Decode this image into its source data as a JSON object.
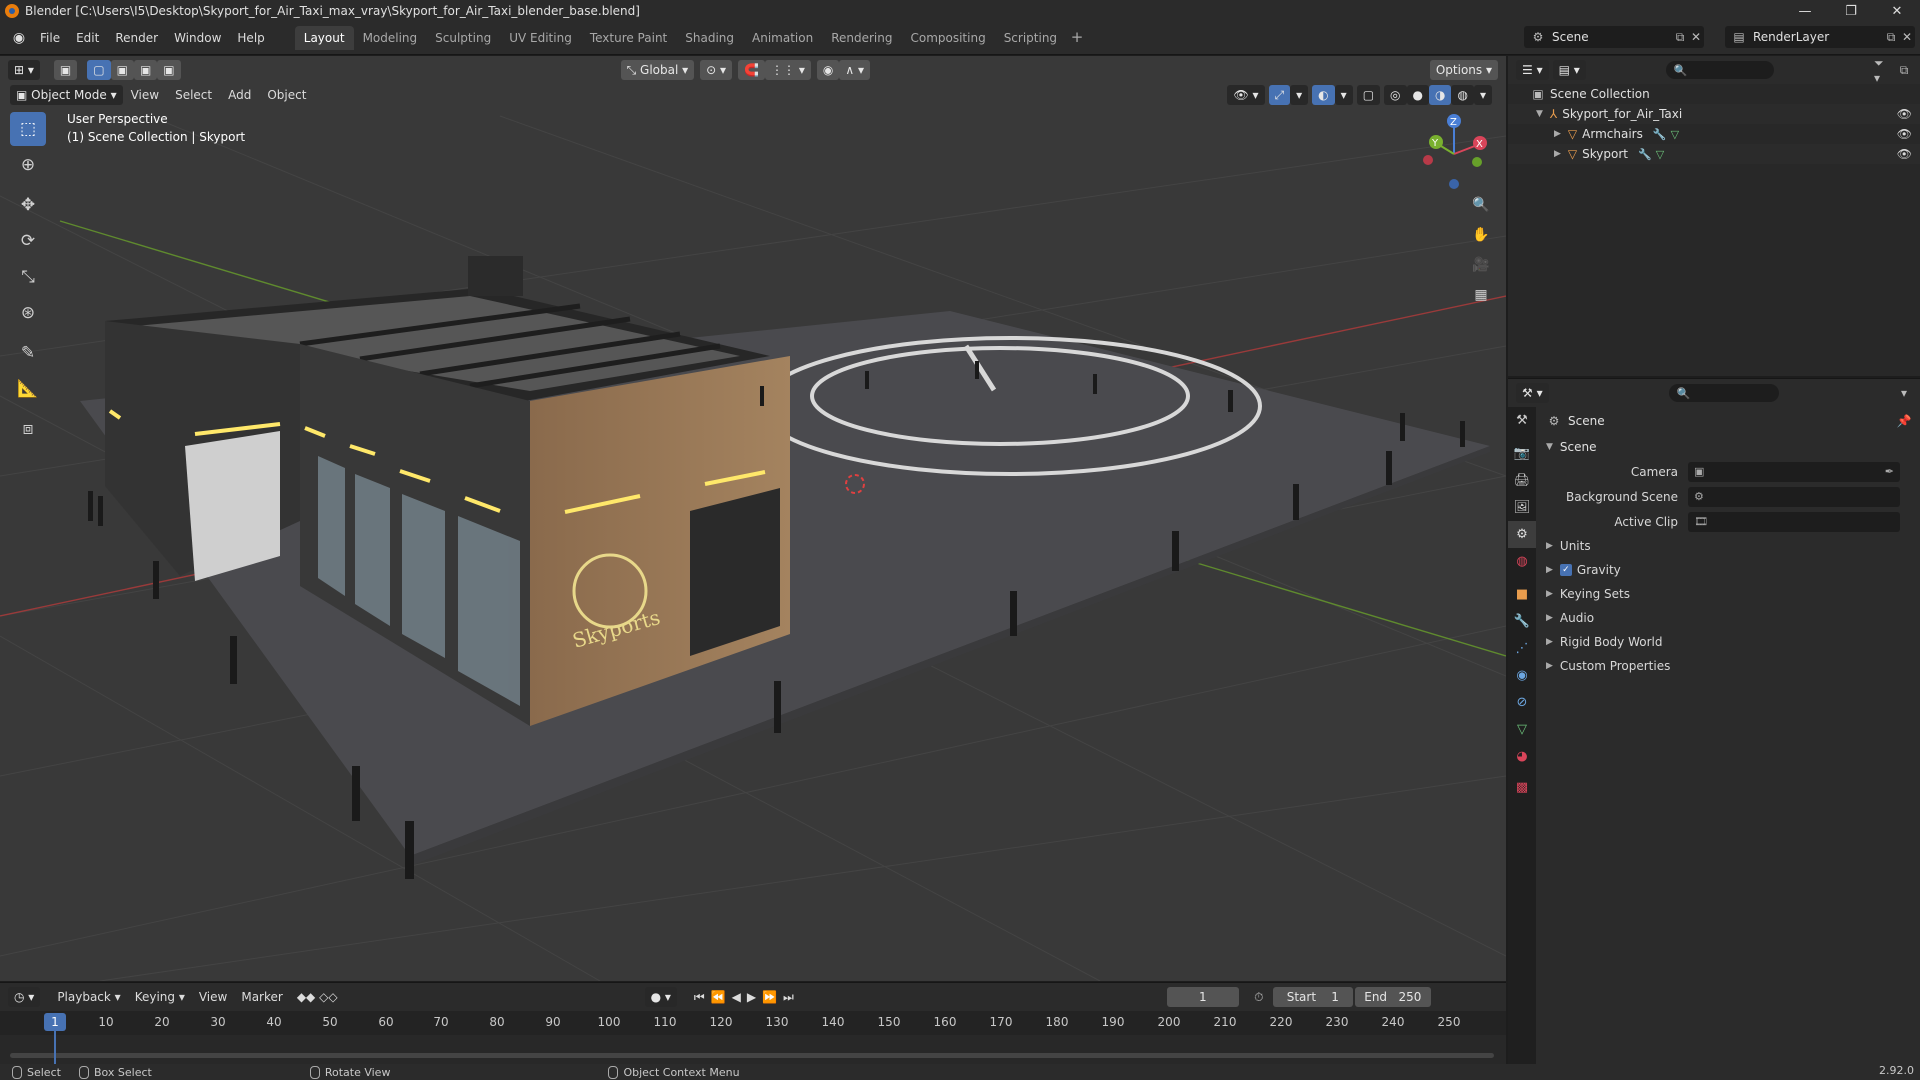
{
  "window": {
    "title": "Blender [C:\\Users\\I5\\Desktop\\Skyport_for_Air_Taxi_max_vray\\Skyport_for_Air_Taxi_blender_base.blend]",
    "minimize": "—",
    "maximize": "❐",
    "close": "✕"
  },
  "menu": [
    "File",
    "Edit",
    "Render",
    "Window",
    "Help"
  ],
  "workspaces": [
    {
      "label": "Layout",
      "active": true
    },
    {
      "label": "Modeling"
    },
    {
      "label": "Sculpting"
    },
    {
      "label": "UV Editing"
    },
    {
      "label": "Texture Paint"
    },
    {
      "label": "Shading"
    },
    {
      "label": "Animation"
    },
    {
      "label": "Rendering"
    },
    {
      "label": "Compositing"
    },
    {
      "label": "Scripting"
    }
  ],
  "top_right": {
    "scene": "Scene",
    "view_layer": "RenderLayer"
  },
  "viewport": {
    "transform_orientation": "Global",
    "options": "Options",
    "mode": "Object Mode",
    "menus": [
      "View",
      "Select",
      "Add",
      "Object"
    ],
    "overlay_line1": "User Perspective",
    "overlay_line2": "(1) Scene Collection | Skyport",
    "gizmo": {
      "x": "X",
      "y": "Y",
      "z": "Z"
    },
    "signage": "Skyports"
  },
  "timeline": {
    "menus": [
      "Playback",
      "Keying",
      "View",
      "Marker"
    ],
    "current_frame": "1",
    "start_label": "Start",
    "start": "1",
    "end_label": "End",
    "end": "250",
    "ticks": [
      "10",
      "20",
      "30",
      "40",
      "50",
      "60",
      "70",
      "80",
      "90",
      "100",
      "110",
      "120",
      "130",
      "140",
      "150",
      "160",
      "170",
      "180",
      "190",
      "200",
      "210",
      "220",
      "230",
      "240",
      "250"
    ],
    "marker": "1"
  },
  "statusbar": {
    "select": "Select",
    "box_select": "Box Select",
    "rotate": "Rotate View",
    "context": "Object Context Menu",
    "version": "2.92.0"
  },
  "outliner": {
    "root": "Scene Collection",
    "items": [
      {
        "label": "Skyport_for_Air_Taxi"
      },
      {
        "label": "Armchairs"
      },
      {
        "label": "Skyport"
      }
    ]
  },
  "properties": {
    "context": "Scene",
    "panel": "Scene",
    "camera_label": "Camera",
    "bg_scene_label": "Background Scene",
    "active_clip_label": "Active Clip",
    "subpanels": [
      "Units",
      "Gravity",
      "Keying Sets",
      "Audio",
      "Rigid Body World",
      "Custom Properties"
    ]
  },
  "colors": {
    "accent": "#4772b3",
    "bg": "#393939",
    "panel": "#2b2b2b"
  }
}
